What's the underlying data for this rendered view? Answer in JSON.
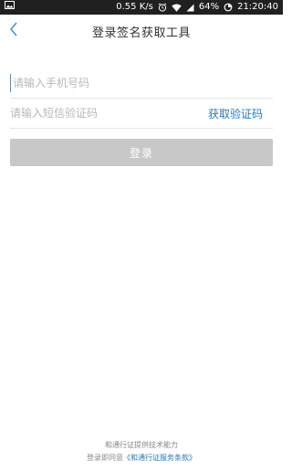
{
  "status_bar": {
    "network_speed": "0.55 K/s",
    "battery": "64%",
    "time": "21:20:40",
    "icons": [
      "image-icon",
      "alarm-icon",
      "wifi-icon",
      "signal-icon",
      "data-saver-icon"
    ]
  },
  "header": {
    "title": "登录签名获取工具",
    "back_icon": "chevron-left-icon"
  },
  "form": {
    "phone_placeholder": "请输入手机号码",
    "phone_value": "",
    "code_placeholder": "请输入短信验证码",
    "code_value": "",
    "get_code_label": "获取验证码",
    "login_label": "登录"
  },
  "footer": {
    "provider_text": "和通行证提供技术能力",
    "agree_prefix": "登录即同意",
    "terms_link": "《和通行证服务条款》"
  },
  "colors": {
    "status_bar_bg": "#202020",
    "accent": "#2a7ab3",
    "button_disabled": "#c8c8c8",
    "placeholder": "#b8b8b8"
  }
}
